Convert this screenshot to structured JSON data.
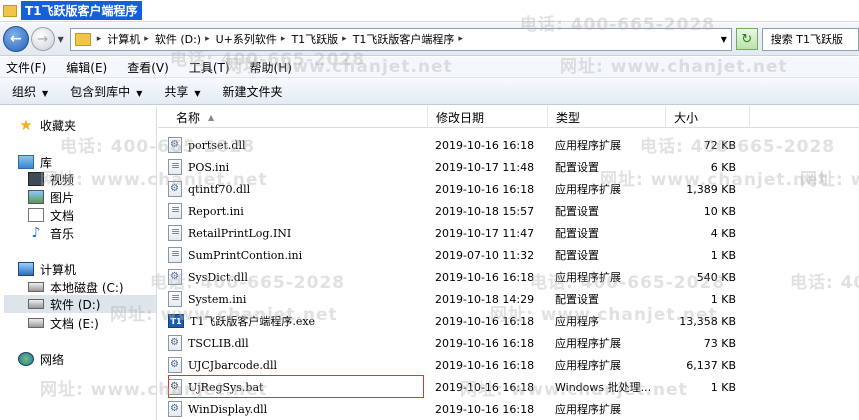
{
  "window": {
    "title": "T1飞跃版客户端程序"
  },
  "address": {
    "crumbs": [
      "计算机",
      "软件 (D:)",
      "U+系列软件",
      "T1飞跃版",
      "T1飞跃版客户端程序"
    ],
    "search_placeholder": "搜索 T1飞跃版"
  },
  "menu": [
    "文件(F)",
    "编辑(E)",
    "查看(V)",
    "工具(T)",
    "帮助(H)"
  ],
  "toolbar": {
    "organize": "组织",
    "include_library": "包含到库中",
    "share": "共享",
    "new_folder": "新建文件夹"
  },
  "nav": {
    "favorites": "收藏夹",
    "libraries": "库",
    "lib_items": [
      "视频",
      "图片",
      "文档",
      "音乐"
    ],
    "computer": "计算机",
    "drives": [
      "本地磁盘 (C:)",
      "软件 (D:)",
      "文档 (E:)"
    ],
    "network": "网络"
  },
  "columns": {
    "name": "名称",
    "date": "修改日期",
    "type": "类型",
    "size": "大小"
  },
  "files": [
    {
      "name": "portset.dll",
      "date": "2019-10-16 16:18",
      "type": "应用程序扩展",
      "size": "72 KB",
      "icon": "gear-icon"
    },
    {
      "name": "POS.ini",
      "date": "2019-10-17 11:48",
      "type": "配置设置",
      "size": "6 KB",
      "icon": "text-icon"
    },
    {
      "name": "qtintf70.dll",
      "date": "2019-10-16 16:18",
      "type": "应用程序扩展",
      "size": "1,389 KB",
      "icon": "gear-icon"
    },
    {
      "name": "Report.ini",
      "date": "2019-10-18 15:57",
      "type": "配置设置",
      "size": "10 KB",
      "icon": "text-icon"
    },
    {
      "name": "RetailPrintLog.INI",
      "date": "2019-10-17 11:47",
      "type": "配置设置",
      "size": "4 KB",
      "icon": "text-icon"
    },
    {
      "name": "SumPrintContion.ini",
      "date": "2019-07-10 11:32",
      "type": "配置设置",
      "size": "1 KB",
      "icon": "text-icon"
    },
    {
      "name": "SysDict.dll",
      "date": "2019-10-16 16:18",
      "type": "应用程序扩展",
      "size": "540 KB",
      "icon": "gear-icon"
    },
    {
      "name": "System.ini",
      "date": "2019-10-18 14:29",
      "type": "配置设置",
      "size": "1 KB",
      "icon": "text-icon"
    },
    {
      "name": "T1飞跃版客户端程序.exe",
      "date": "2019-10-16 16:18",
      "type": "应用程序",
      "size": "13,358 KB",
      "icon": "app-icon",
      "icon_label": "T1"
    },
    {
      "name": "TSCLIB.dll",
      "date": "2019-10-16 16:18",
      "type": "应用程序扩展",
      "size": "73 KB",
      "icon": "gear-icon"
    },
    {
      "name": "UJCJbarcode.dll",
      "date": "2019-10-16 16:18",
      "type": "应用程序扩展",
      "size": "6,137 KB",
      "icon": "gear-icon"
    },
    {
      "name": "UjRegSys.bat",
      "date": "2019-10-16 16:18",
      "type": "Windows 批处理...",
      "size": "1 KB",
      "icon": "batch-icon"
    },
    {
      "name": "WinDisplay.dll",
      "date": "2019-10-16 16:18",
      "type": "应用程序扩展",
      "size": "",
      "icon": "gear-icon"
    }
  ],
  "watermark": {
    "phone": "电话: 400-665-2028",
    "site": "网址: www.chanjet.net"
  },
  "colors": {
    "highlight": "#e0322e",
    "title_bg": "#1560d8"
  }
}
